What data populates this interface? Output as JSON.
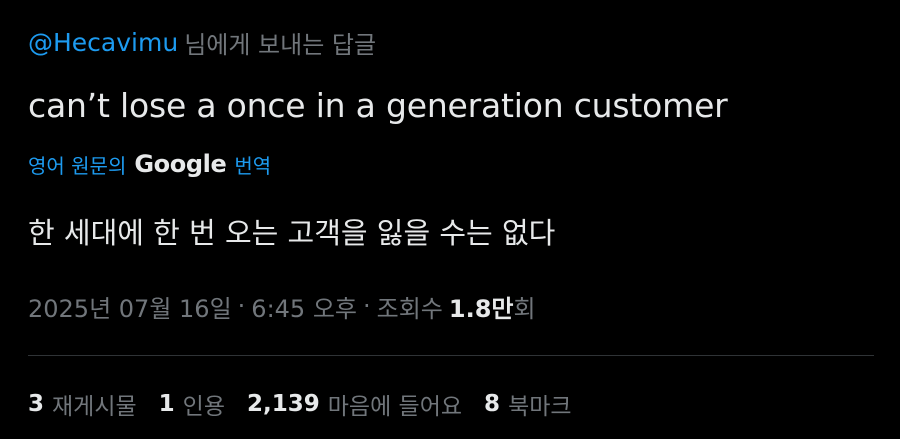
{
  "colors": {
    "background": "#000000",
    "primary_text": "#e7e9ea",
    "secondary_text": "#71767b",
    "accent": "#1d9bf0",
    "divider": "#2f3336"
  },
  "reply": {
    "handle": "@Hecavimu",
    "suffix": "님에게 보내는 답글"
  },
  "tweet": {
    "text": "can’t lose a once in a generation customer"
  },
  "translation": {
    "prefix": "영어 원문의",
    "provider": "Google",
    "action": "번역",
    "text": "한 세대에 한 번 오는 고객을 잃을 수는 없다"
  },
  "meta": {
    "date": "2025년 07월 16일",
    "separator": "·",
    "time": "6:45 오후",
    "views_label": "조회수",
    "views_number": "1.8만",
    "views_suffix": "회"
  },
  "stats": {
    "reposts": {
      "count": "3",
      "label": "재게시물"
    },
    "quotes": {
      "count": "1",
      "label": "인용"
    },
    "likes": {
      "count": "2,139",
      "label": "마음에 들어요"
    },
    "bookmarks": {
      "count": "8",
      "label": "북마크"
    }
  }
}
